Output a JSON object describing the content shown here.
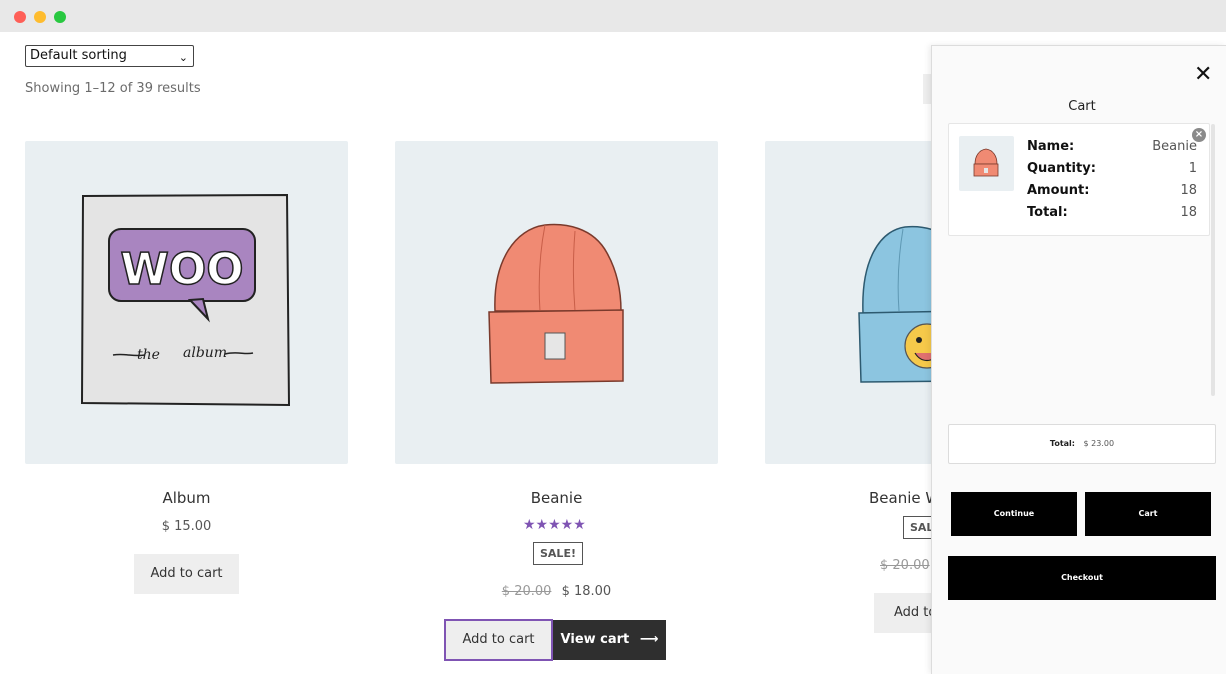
{
  "window": {
    "controls": [
      "close",
      "minimize",
      "maximize"
    ]
  },
  "shop": {
    "sorting": {
      "selected": "Default sorting"
    },
    "result_count": "Showing 1–12 of 39 results"
  },
  "products": [
    {
      "title": "Album",
      "price": "$ 15.00",
      "button": "Add to cart"
    },
    {
      "title": "Beanie",
      "sale_badge": "SALE!",
      "old_price": "$ 20.00",
      "price": "$ 18.00",
      "rating": 5,
      "button": "Add to cart",
      "view_cart": "View cart"
    },
    {
      "title": "Beanie W",
      "sale_badge": "SAL",
      "old_price": "$ 20.00",
      "button": "Add to"
    }
  ],
  "cart_drawer": {
    "title": "Cart",
    "item": {
      "name_label": "Name:",
      "name": "Beanie",
      "quantity_label": "Quantity:",
      "quantity": "1",
      "amount_label": "Amount:",
      "amount": "18",
      "total_label": "Total:",
      "total": "18"
    },
    "total_label": "Total:",
    "total_value": "$ 23.00",
    "continue_label": "Continue",
    "cart_label": "Cart",
    "checkout_label": "Checkout"
  },
  "colors": {
    "accent": "#7f54b3",
    "dark_button": "#2f2f2f",
    "product_bg": "#e9eff2",
    "beanie": "#f08a73",
    "hoodie_blue": "#8cc5e0"
  },
  "icons": {
    "close": "close-icon",
    "remove": "remove-item-icon",
    "select": "chevron-down-icon",
    "arrow": "arrow-right-icon"
  }
}
